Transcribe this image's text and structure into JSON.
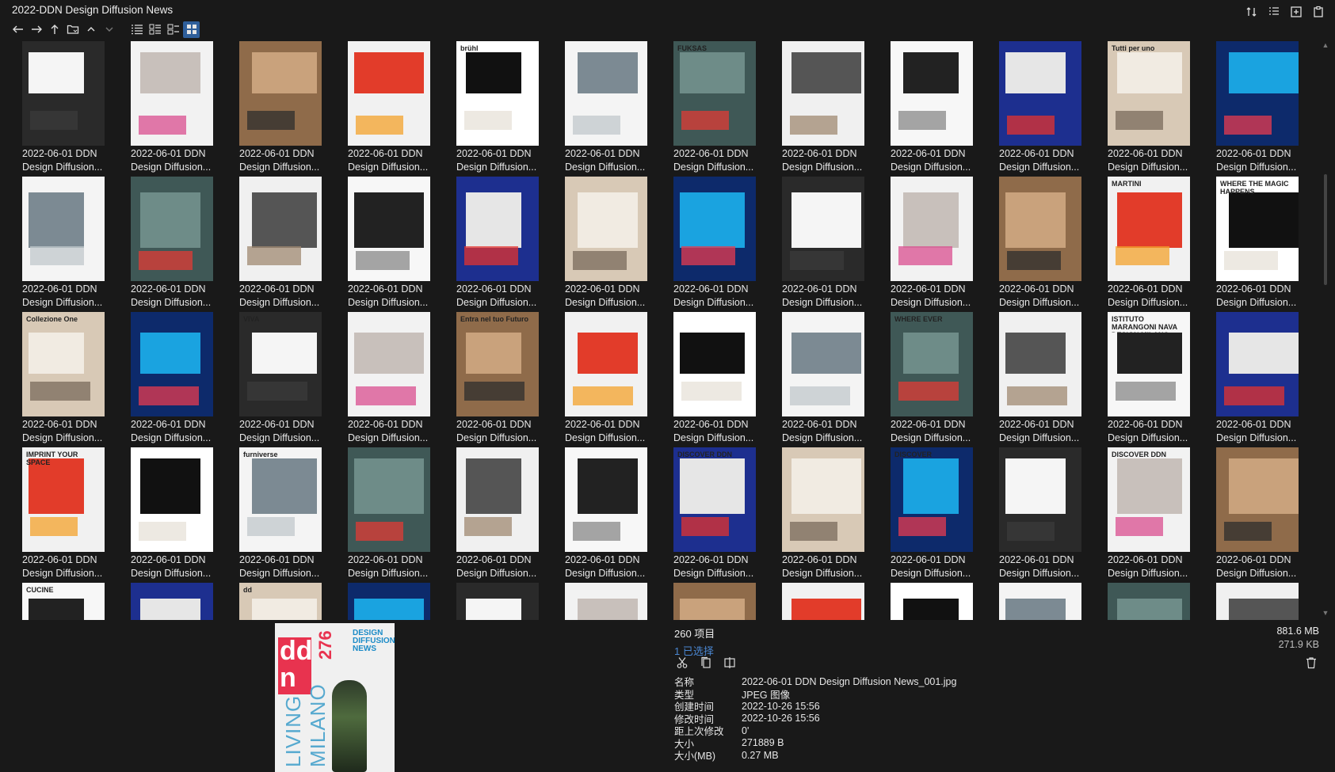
{
  "window": {
    "title": "2022-DDN Design Diffusion News"
  },
  "toolbar": {
    "icons": [
      "sort-icon",
      "details-pane-icon",
      "new-window-icon",
      "clipboard-icon"
    ],
    "nav": [
      "back-arrow-icon",
      "forward-arrow-icon",
      "up-arrow-icon",
      "folder-icon",
      "chevron-up-icon",
      "chevron-down-icon"
    ],
    "views": [
      "list-view-icon",
      "details-view-icon",
      "tiles-view-icon",
      "thumbnail-view-icon"
    ]
  },
  "file_label": {
    "line1": "2022-06-01 DDN",
    "line2": "Design Diffusion..."
  },
  "info": {
    "count": "260 项目",
    "selected": "1 已选择",
    "total_size": "881.6 MB",
    "selected_size": "271.9 KB",
    "props": [
      {
        "key": "名称",
        "value": "2022-06-01 DDN Design Diffusion News_001.jpg"
      },
      {
        "key": "类型",
        "value": "JPEG 图像"
      },
      {
        "key": "创建时间",
        "value": "2022-10-26  15:56"
      },
      {
        "key": "修改时间",
        "value": "2022-10-26  15:56"
      },
      {
        "key": "距上次修改",
        "value": "0'"
      },
      {
        "key": "大小",
        "value": "271889 B"
      },
      {
        "key": "大小(MB)",
        "value": "0.27 MB"
      }
    ]
  },
  "preview": {
    "logo": "dd n",
    "issue": "276",
    "brand": "DESIGN DIFFUSION NEWS",
    "feature": "LIVING MILANO"
  },
  "thumbnail_text": {
    "r0": [
      "",
      "",
      "",
      "",
      "brühl",
      "",
      "FUKSAS",
      "",
      "",
      "",
      "Tutti per uno",
      ""
    ],
    "r1": [
      "",
      "",
      "",
      "",
      "",
      "",
      "",
      "",
      "",
      "",
      "MARTINI",
      "WHERE THE MAGIC HAPPENS"
    ],
    "r2": [
      "Collezione One",
      "",
      "VIVA",
      "",
      "Entra nel tuo Futuro",
      "",
      "",
      "",
      "WHERE EVER",
      "",
      "ISTITUTO MARANGONI NAVA DESIGN MILANO",
      ""
    ],
    "r3": [
      "IMPRINT YOUR SPACE",
      "",
      "furniverse",
      "",
      "",
      "",
      "DISCOVER DDN",
      "",
      "DISCOVER",
      "",
      "DISCOVER DDN",
      ""
    ],
    "r4": [
      "CUCINE",
      "",
      "dd",
      "",
      "",
      "",
      "",
      "",
      "",
      "",
      "",
      ""
    ]
  },
  "colors": {
    "background": "#191919",
    "accent": "#2f5f9b",
    "link": "#4a86d1",
    "ddn_red": "#e8334f"
  }
}
